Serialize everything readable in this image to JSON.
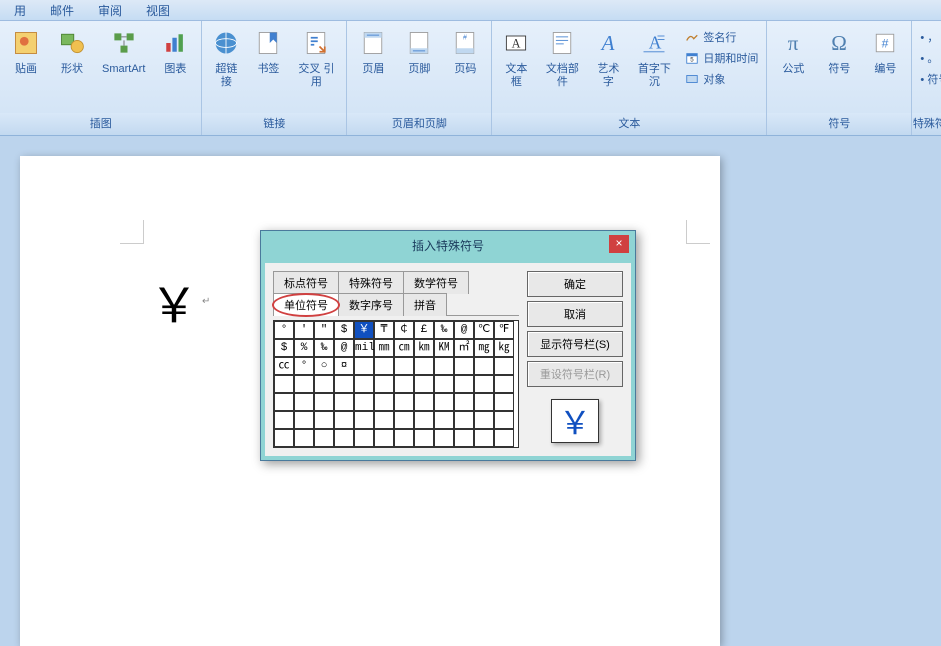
{
  "menubar": [
    "用",
    "邮件",
    "审阅",
    "视图"
  ],
  "ribbon": {
    "groups": [
      {
        "label": "插图",
        "buttons": [
          {
            "label": "贴画",
            "icon": "clipart"
          },
          {
            "label": "形状",
            "icon": "shapes"
          },
          {
            "label": "SmartArt",
            "icon": "smartart"
          },
          {
            "label": "图表",
            "icon": "chart"
          }
        ]
      },
      {
        "label": "链接",
        "buttons": [
          {
            "label": "超链接",
            "icon": "hyperlink"
          },
          {
            "label": "书签",
            "icon": "bookmark"
          },
          {
            "label": "交叉\n引用",
            "icon": "crossref"
          }
        ]
      },
      {
        "label": "页眉和页脚",
        "buttons": [
          {
            "label": "页眉",
            "icon": "header"
          },
          {
            "label": "页脚",
            "icon": "footer"
          },
          {
            "label": "页码",
            "icon": "pagenum"
          }
        ]
      },
      {
        "label": "文本",
        "buttons": [
          {
            "label": "文本框",
            "icon": "textbox"
          },
          {
            "label": "文档部件",
            "icon": "parts"
          },
          {
            "label": "艺术字",
            "icon": "wordart"
          },
          {
            "label": "首字下沉",
            "icon": "dropcap"
          }
        ],
        "small": [
          {
            "label": "签名行",
            "icon": "sig"
          },
          {
            "label": "日期和时间",
            "icon": "date"
          },
          {
            "label": "对象",
            "icon": "obj"
          }
        ]
      },
      {
        "label": "符号",
        "buttons": [
          {
            "label": "公式",
            "icon": "equation"
          },
          {
            "label": "符号",
            "icon": "symbol"
          },
          {
            "label": "编号",
            "icon": "number"
          }
        ]
      },
      {
        "label": "特殊符号",
        "small2": [
          {
            "label": "，",
            "icon": ""
          },
          {
            "label": "。",
            "icon": ""
          },
          {
            "label": "符号",
            "icon": ""
          }
        ]
      }
    ]
  },
  "document": {
    "inserted_char": "￥",
    "cursor": "↵"
  },
  "dialog": {
    "title": "插入特殊符号",
    "close": "×",
    "tabs_row1": [
      "标点符号",
      "特殊符号",
      "数学符号"
    ],
    "tabs_row2": [
      "单位符号",
      "数字序号",
      "拼音"
    ],
    "active_tab": "单位符号",
    "grid": [
      [
        "°",
        "′",
        "″",
        "$",
        "￥",
        "₸",
        "￠",
        "£",
        "‰",
        "@",
        "℃",
        "℉"
      ],
      [
        "$",
        "%",
        "‰",
        "@",
        "mil",
        "㎜",
        "㎝",
        "㎞",
        "㏎",
        "㎡",
        "㎎",
        "㎏"
      ],
      [
        "㏄",
        "°",
        "○",
        "¤",
        "",
        "",
        "",
        "",
        "",
        "",
        "",
        ""
      ],
      [
        "",
        "",
        "",
        "",
        "",
        "",
        "",
        "",
        "",
        "",
        "",
        ""
      ],
      [
        "",
        "",
        "",
        "",
        "",
        "",
        "",
        "",
        "",
        "",
        "",
        ""
      ],
      [
        "",
        "",
        "",
        "",
        "",
        "",
        "",
        "",
        "",
        "",
        "",
        ""
      ],
      [
        "",
        "",
        "",
        "",
        "",
        "",
        "",
        "",
        "",
        "",
        "",
        ""
      ]
    ],
    "selected_row": 0,
    "selected_col": 4,
    "buttons": {
      "ok": "确定",
      "cancel": "取消",
      "show_bar": "显示符号栏(S)",
      "reset_bar": "重设符号栏(R)"
    },
    "preview": "￥"
  }
}
